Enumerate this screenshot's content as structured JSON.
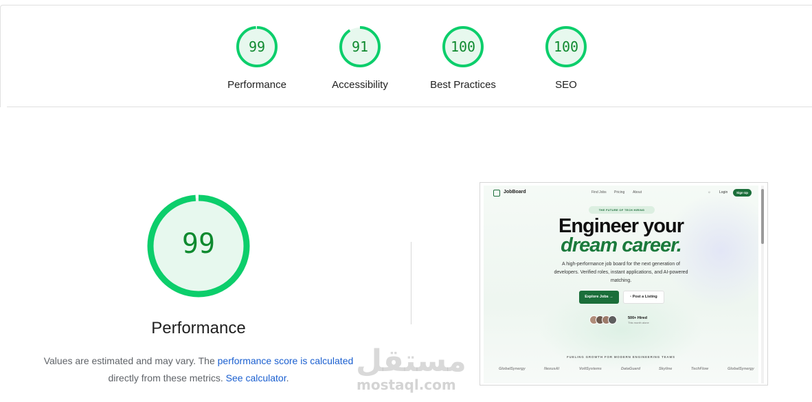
{
  "summary": {
    "gauges": [
      {
        "score": "99",
        "value": 99,
        "label": "Performance"
      },
      {
        "score": "91",
        "value": 91,
        "label": "Accessibility"
      },
      {
        "score": "100",
        "value": 100,
        "label": "Best Practices"
      },
      {
        "score": "100",
        "value": 100,
        "label": "SEO"
      }
    ]
  },
  "performance": {
    "score": "99",
    "value": 99,
    "title": "Performance",
    "desc_prefix": "Values are estimated and may vary. The ",
    "link1": "performance score is calculated",
    "desc_middle": " directly from these metrics. ",
    "link2": "See calculator",
    "desc_suffix": "."
  },
  "colors": {
    "pass": "#0cce6b",
    "pass_text": "#0f8a2f",
    "pass_fill": "#e7f8ee",
    "link": "#1a5fd0",
    "brand_green": "#1b6e3a"
  },
  "screenshot": {
    "logo": "JobBoard",
    "nav_links": [
      "Find Jobs",
      "Pricing",
      "About"
    ],
    "login": "Login",
    "signup": "Sign Up",
    "pill": "THE FUTURE OF TECH HIRING",
    "headline1": "Engineer your",
    "headline2": "dream career.",
    "subtitle": "A high-performance job board for the next generation of developers. Verified roles, instant applications, and AI-powered matching.",
    "btn_explore": "Explore Jobs",
    "btn_post": "Post a Listing",
    "hired": "500+ Hired",
    "hired_sub": "This month alone",
    "fueling": "FUELING GROWTH FOR MODERN ENGINEERING TEAMS",
    "brands": [
      "GlobalSynergy",
      "NexusAI",
      "VoltSystems",
      "DataGuard",
      "Skyline",
      "TechFlow",
      "GlobalSynergy"
    ]
  },
  "watermark": {
    "arabic": "مستقل",
    "latin": "mostaql.com"
  }
}
